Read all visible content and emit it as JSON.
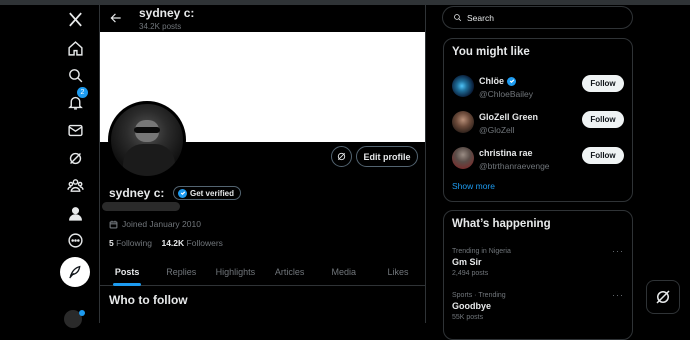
{
  "nav": {
    "notifications_count": "2"
  },
  "header": {
    "name": "sydney c:",
    "posts": "34.2K posts"
  },
  "profile": {
    "name": "sydney c:",
    "verify_label": "Get verified",
    "edit_label": "Edit profile",
    "joined": "Joined January 2010",
    "following_count": "5",
    "following_label": "Following",
    "followers_count": "14.2K",
    "followers_label": "Followers"
  },
  "tabs": [
    "Posts",
    "Replies",
    "Highlights",
    "Articles",
    "Media",
    "Likes"
  ],
  "main": {
    "who_to_follow": "Who to follow"
  },
  "search": {
    "placeholder": "Search"
  },
  "might_like": {
    "title": "You might like",
    "users": [
      {
        "name": "Chlöe",
        "handle": "@ChloeBailey",
        "verified": true,
        "follow": "Follow"
      },
      {
        "name": "GloZell Green",
        "handle": "@GloZell",
        "verified": false,
        "follow": "Follow"
      },
      {
        "name": "christina rae",
        "handle": "@btrthanraevenge",
        "verified": false,
        "follow": "Follow"
      }
    ],
    "show_more": "Show more"
  },
  "happening": {
    "title": "What’s happening",
    "trends": [
      {
        "context": "Trending in Nigeria",
        "title": "Gm Sir",
        "count": "2,494 posts"
      },
      {
        "context": "Sports · Trending",
        "title": "Goodbye",
        "count": "55K posts"
      }
    ]
  },
  "colors": {
    "accent": "#1d9bf0",
    "bg": "#000000",
    "border": "#2f3336",
    "muted": "#71767b"
  }
}
